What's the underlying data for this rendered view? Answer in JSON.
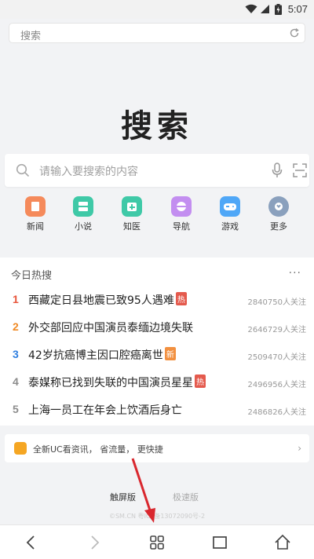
{
  "status_bar": {
    "time": "5:07"
  },
  "top_search": {
    "placeholder": "搜索"
  },
  "brand": {
    "title": "搜索"
  },
  "main_search": {
    "placeholder": "请输入要搜索的内容"
  },
  "shortcuts": [
    {
      "label": "新闻",
      "color": "#f58a5b",
      "icon": "news-icon"
    },
    {
      "label": "小说",
      "color": "#3fc9a7",
      "icon": "book-icon"
    },
    {
      "label": "知医",
      "color": "#3fc9a7",
      "icon": "medical-icon"
    },
    {
      "label": "导航",
      "color": "#c38ef0",
      "icon": "navigation-icon"
    },
    {
      "label": "游戏",
      "color": "#4fa7f7",
      "icon": "gamepad-icon"
    },
    {
      "label": "更多",
      "color": "#8aa0bd",
      "icon": "more-icon"
    }
  ],
  "hot": {
    "heading": "今日热搜",
    "more": "···",
    "items": [
      {
        "rank": "1",
        "rank_color": "#e8553b",
        "title": "西藏定日县地震已致95人遇难",
        "tag": "热",
        "tag_type": "hot",
        "count": "2840750人关注"
      },
      {
        "rank": "2",
        "rank_color": "#f08a24",
        "title": "外交部回应中国演员泰缅边境失联",
        "tag": "",
        "tag_type": "",
        "count": "2646729人关注"
      },
      {
        "rank": "3",
        "rank_color": "#2f7fe0",
        "title": "42岁抗癌博主因口腔癌离世",
        "tag": "新",
        "tag_type": "new",
        "count": "2509470人关注"
      },
      {
        "rank": "4",
        "rank_color": "#8c8c8c",
        "title": "泰媒称已找到失联的中国演员星星",
        "tag": "热",
        "tag_type": "hot",
        "count": "2496956人关注"
      },
      {
        "rank": "5",
        "rank_color": "#8c8c8c",
        "title": "上海一员工在年会上饮酒后身亡",
        "tag": "",
        "tag_type": "",
        "count": "2486826人关注"
      }
    ]
  },
  "banner": {
    "text": "全新UC看资讯， 省流量， 更快捷"
  },
  "modes": {
    "touch": "触屏版",
    "fast": "极速版"
  },
  "footer": {
    "note": "©SM.CN 粤ICP备13072090号-2"
  }
}
